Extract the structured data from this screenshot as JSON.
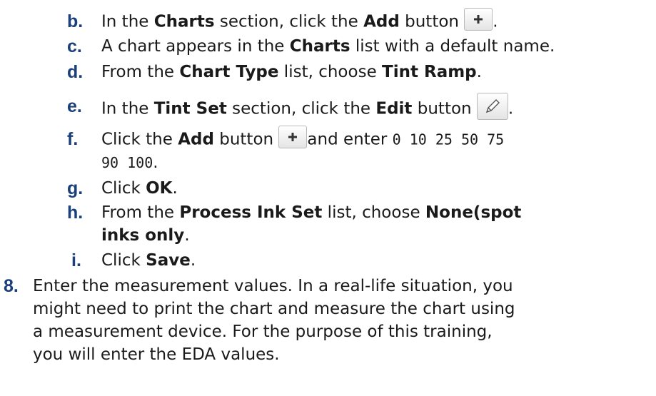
{
  "steps": {
    "b": {
      "label": "b.",
      "t1": "In the ",
      "b1": "Charts",
      "t2": " section, click the ",
      "b2": "Add",
      "t3": " button ",
      "t4": "."
    },
    "c": {
      "label": "c.",
      "t1": "A chart appears in the ",
      "b1": "Charts",
      "t2": " list with a default name."
    },
    "d": {
      "label": "d.",
      "t1": "From the ",
      "b1": "Chart Type",
      "t2": " list, choose ",
      "b2": "Tint Ramp",
      "t3": "."
    },
    "e": {
      "label": "e.",
      "t1": "In the ",
      "b1": "Tint Set",
      "t2": " section, click the ",
      "b2": "Edit",
      "t3": " button ",
      "t4": "."
    },
    "f": {
      "label": "f.",
      "t1": "Click the ",
      "b1": "Add",
      "t2": " button ",
      "t3": "and enter ",
      "code1": "0 10 25 50 75",
      "code2": "90 100",
      "t4": "."
    },
    "g": {
      "label": "g.",
      "t1": "Click ",
      "b1": "OK",
      "t2": "."
    },
    "h": {
      "label": "h.",
      "t1": "From the ",
      "b1": "Process Ink Set",
      "t2": " list, choose ",
      "b2": "None(spot",
      "b3": "inks only",
      "t3": "."
    },
    "i": {
      "label": "i.",
      "t1": "Click ",
      "b1": "Save",
      "t2": "."
    },
    "step8": {
      "label": "8.",
      "lines": [
        "Enter the measurement values. In a real-life situation, you",
        "might need to print the chart and measure the chart using",
        "a measurement device. For the purpose of this training,",
        "you will enter the EDA values."
      ]
    }
  },
  "icons": {
    "add": "plus-icon",
    "edit": "pencil-icon"
  },
  "colors": {
    "label": "#1a3f7a",
    "text": "#1a1a1a"
  }
}
